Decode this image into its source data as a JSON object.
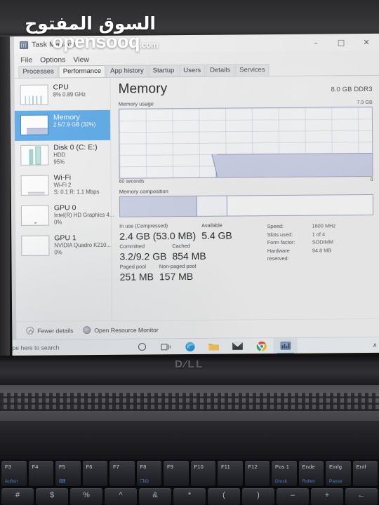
{
  "window": {
    "title": "Task Manager",
    "icon": "task-manager-icon",
    "controls": {
      "minimize": "–",
      "maximize": "□",
      "close": "✕"
    }
  },
  "menu": {
    "items": [
      "File",
      "Options",
      "View"
    ]
  },
  "tabs": [
    {
      "label": "Processes",
      "active": false
    },
    {
      "label": "Performance",
      "active": true
    },
    {
      "label": "App history",
      "active": false
    },
    {
      "label": "Startup",
      "active": false
    },
    {
      "label": "Users",
      "active": false
    },
    {
      "label": "Details",
      "active": false
    },
    {
      "label": "Services",
      "active": false
    }
  ],
  "sidebar": {
    "items": [
      {
        "name": "CPU",
        "line1": "8%  0.89 GHz",
        "line2": "",
        "selected": false
      },
      {
        "name": "Memory",
        "line1": "2.5/7.9 GB (32%)",
        "line2": "",
        "selected": true
      },
      {
        "name": "Disk 0 (C: E:)",
        "line1": "HDD",
        "line2": "95%",
        "selected": false
      },
      {
        "name": "Wi-Fi",
        "line1": "Wi-Fi 2",
        "line2": "S: 0.1 R: 1.1 Mbps",
        "selected": false
      },
      {
        "name": "GPU 0",
        "line1": "Intel(R) HD Graphics 4...",
        "line2": "0%",
        "selected": false
      },
      {
        "name": "GPU 1",
        "line1": "NVIDIA Quadro K210...",
        "line2": "0%",
        "selected": false
      }
    ]
  },
  "main": {
    "title": "Memory",
    "spec": "8.0 GB DDR3",
    "usage_label": "Memory usage",
    "usage_max": "7.9 GB",
    "graph_left": "60 seconds",
    "graph_right": "0",
    "composition_label": "Memory composition",
    "stats": {
      "in_use_cap": "In use (Compressed)",
      "in_use_val": "2.4 GB (53.0 MB)",
      "available_cap": "Available",
      "available_val": "5.4 GB",
      "committed_cap": "Committed",
      "committed_val": "3.2/9.2 GB",
      "cached_cap": "Cached",
      "cached_val": "854 MB",
      "paged_cap": "Paged pool",
      "paged_val": "251 MB",
      "nonpaged_cap": "Non-paged pool",
      "nonpaged_val": "157 MB"
    },
    "details": [
      {
        "key": "Speed:",
        "value": "1600 MHz"
      },
      {
        "key": "Slots used:",
        "value": "1 of 4"
      },
      {
        "key": "Form factor:",
        "value": "SODIMM"
      },
      {
        "key": "Hardware reserved:",
        "value": "94.8 MB"
      }
    ]
  },
  "status": {
    "fewer_details": "Fewer details",
    "resource_monitor": "Open Resource Monitor"
  },
  "taskbar": {
    "search_placeholder": "pe here to search",
    "icons": [
      {
        "name": "cortana-icon",
        "glyph": "○",
        "color": "#4a4f54",
        "active": false
      },
      {
        "name": "task-view-icon",
        "glyph": "⌸",
        "color": "#4a4f54",
        "active": false
      },
      {
        "name": "edge-icon",
        "glyph": "◕",
        "color": "#2b8ad0",
        "active": false
      },
      {
        "name": "file-explorer-icon",
        "glyph": "▬",
        "color": "#e8b councils",
        "active": false
      },
      {
        "name": "mail-icon",
        "glyph": "✉",
        "color": "#3b4045",
        "active": false
      },
      {
        "name": "chrome-icon",
        "glyph": "◉",
        "color": "#e04a3a",
        "active": false
      },
      {
        "name": "task-manager-icon",
        "glyph": "▤",
        "color": "#6a7f9a",
        "active": true
      }
    ],
    "tray_chevron": "∧"
  },
  "laptop": {
    "brand": "D∕LL"
  },
  "watermark": {
    "arabic": "السوق المفتوح",
    "english": "opensooq",
    "suffix": ".com"
  },
  "keyboard": {
    "function_row": [
      {
        "label": "F3",
        "alt": "Auflsn"
      },
      {
        "label": "F4",
        "alt": ""
      },
      {
        "label": "F5",
        "alt": "⌨"
      },
      {
        "label": "F6",
        "alt": ""
      },
      {
        "label": "F7",
        "alt": ""
      },
      {
        "label": "F8",
        "alt": "❐ID"
      },
      {
        "label": "F9",
        "alt": ""
      },
      {
        "label": "F10",
        "alt": ""
      },
      {
        "label": "F11",
        "alt": ""
      },
      {
        "label": "F12",
        "alt": ""
      },
      {
        "label": "Pos 1",
        "alt": "Druck"
      },
      {
        "label": "Ende",
        "alt": "Rollen"
      },
      {
        "label": "Einfg",
        "alt": "Pause"
      },
      {
        "label": "Entf",
        "alt": ""
      }
    ],
    "number_row": [
      "#",
      "$",
      "%",
      "^",
      "&",
      "*",
      "(",
      ")",
      "–",
      "+",
      "←"
    ]
  }
}
